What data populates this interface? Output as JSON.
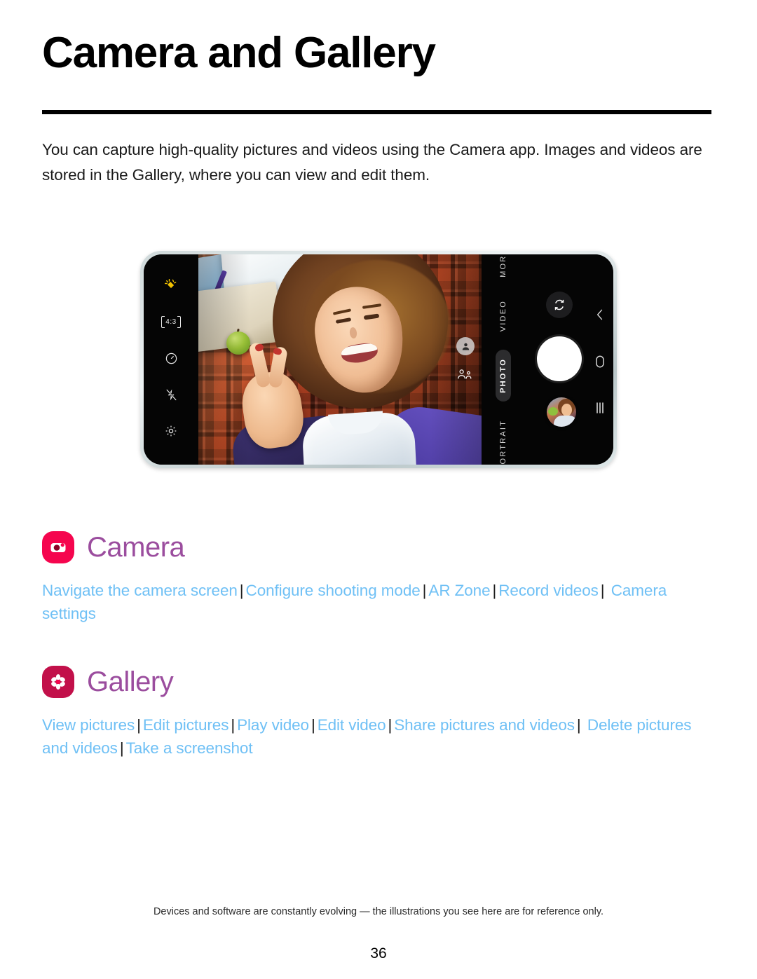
{
  "document": {
    "title": "Camera and Gallery",
    "intro": "You can capture high-quality pictures and videos using the Camera app. Images and videos are stored in the Gallery, where you can view and edit them.",
    "footer_note": "Devices and software are constantly evolving — the illustrations you see here are for reference only.",
    "page_number": "36"
  },
  "colors": {
    "heading_purple": "#9B4D9E",
    "link_blue": "#6FC0F5",
    "camera_icon_bg": "#F5054E",
    "gallery_icon_bg": "#C2104A",
    "rule_black": "#000000"
  },
  "illustration": {
    "caption": "Samsung camera app viewfinder in landscape",
    "left_rail": [
      {
        "name": "magic-sparkle-icon",
        "label": "Scene optimizer"
      },
      {
        "name": "aspect-ratio-icon",
        "label": "4:3"
      },
      {
        "name": "timer-icon",
        "label": "Timer"
      },
      {
        "name": "flash-off-icon",
        "label": "Flash off"
      },
      {
        "name": "settings-gear-icon",
        "label": "Settings"
      }
    ],
    "aspect_ratio_value": "4:3",
    "modes": [
      {
        "label": "MORE",
        "active": false
      },
      {
        "label": "VIDEO",
        "active": false
      },
      {
        "label": "PHOTO",
        "active": true
      },
      {
        "label": "PORTRAIT",
        "active": false
      }
    ],
    "controls": [
      {
        "name": "switch-camera-button",
        "label": "Switch camera"
      },
      {
        "name": "shutter-button",
        "label": "Shutter"
      },
      {
        "name": "gallery-thumbnail-button",
        "label": "Last photo"
      }
    ],
    "viewfinder_overlays": [
      {
        "name": "face-detect-single-icon",
        "label": "Single person framing"
      },
      {
        "name": "face-detect-group-icon",
        "label": "Group framing"
      }
    ],
    "navbar": [
      {
        "name": "back-icon",
        "label": "Back"
      },
      {
        "name": "home-icon",
        "label": "Home"
      },
      {
        "name": "recents-icon",
        "label": "Recents"
      }
    ]
  },
  "sections": [
    {
      "id": "camera",
      "title": "Camera",
      "icon": "camera-app-icon",
      "links": [
        "Navigate the camera screen",
        "Configure shooting mode",
        "AR Zone",
        "Record videos",
        "Camera settings"
      ]
    },
    {
      "id": "gallery",
      "title": "Gallery",
      "icon": "gallery-app-icon",
      "links": [
        "View pictures",
        "Edit pictures",
        "Play video",
        "Edit video",
        "Share pictures and videos",
        "Delete pictures and videos",
        "Take a screenshot"
      ]
    }
  ]
}
